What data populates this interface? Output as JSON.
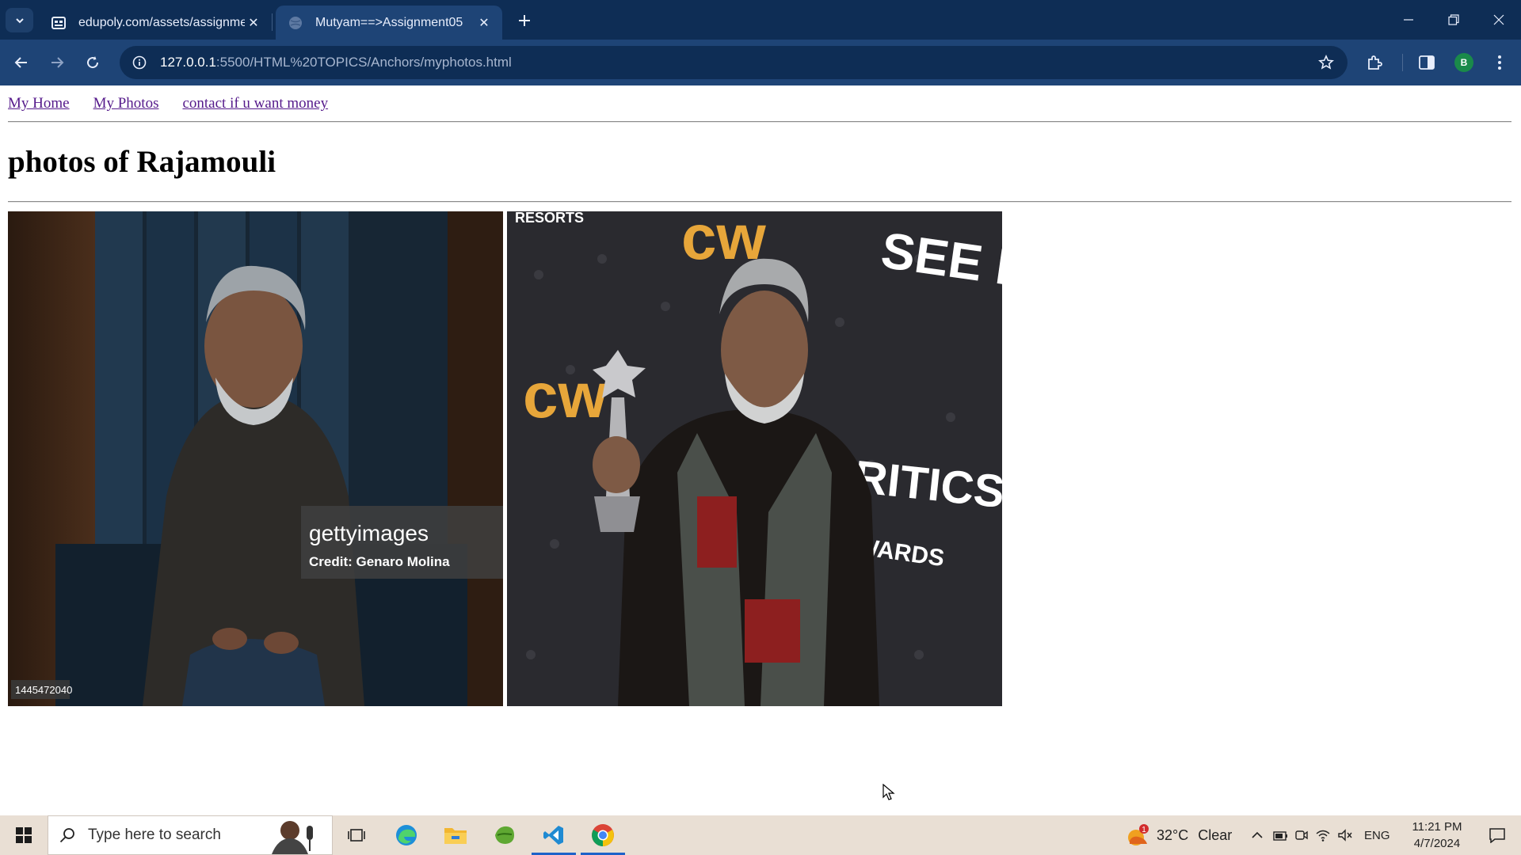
{
  "browser": {
    "tabs": [
      {
        "title": "edupoly.com/assets/assignmen",
        "active": false,
        "favicon": "edupoly-favicon"
      },
      {
        "title": "Mutyam==>Assignment05",
        "active": true,
        "favicon": "globe-favicon"
      }
    ],
    "url_host": "127.0.0.1",
    "url_rest": ":5500/HTML%20TOPICS/Anchors/myphotos.html",
    "profile_initial": "B"
  },
  "page": {
    "nav_links": [
      "My Home",
      "My Photos",
      "contact if u want money"
    ],
    "heading": "photos of Rajamouli",
    "photos": [
      {
        "watermark": "gettyimages",
        "credit": "Credit: Genaro Molina",
        "id_label": "1445472040"
      },
      {
        "signs": [
          "SEE HER",
          "CRITICS CHOICE",
          "AWARDS",
          "RESORTS"
        ]
      }
    ]
  },
  "taskbar": {
    "search_placeholder": "Type here to search",
    "weather_temp": "32°C",
    "weather_text": "Clear",
    "language": "ENG",
    "time": "11:21 PM",
    "date": "4/7/2024",
    "weather_badge": "1"
  },
  "colors": {
    "tabstrip": "#0e2d55",
    "toolbar": "#1e4476",
    "link_visited": "#551a8b",
    "taskbar": "#e9dfd4"
  }
}
